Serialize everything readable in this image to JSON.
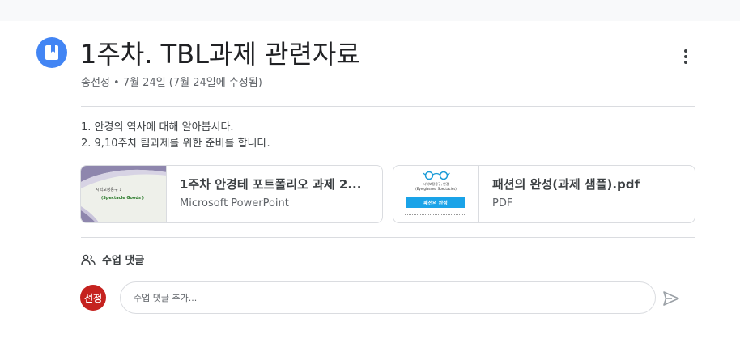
{
  "post": {
    "title": "1주차. TBL과제 관련자료",
    "meta": "송선정 • 7월 24일 (7월 24일에 수정됨)",
    "icon": "assignment-material-icon",
    "accent_color": "#4285f4"
  },
  "description": {
    "lines": [
      "1. 안경의 역사에 대해 알아봅시다.",
      "2. 9,10주차 팀과제를 위한 준비를 합니다."
    ]
  },
  "attachments": [
    {
      "title": "1주차 안경테 포트폴리오 과제 2...",
      "type": "Microsoft PowerPoint",
      "thumb_title": "시력보정용구 1",
      "thumb_subtitle": "(Spectacle Goods )"
    },
    {
      "title": "패션의 완성(과제 샘플).pdf",
      "type": "PDF",
      "thumb_line1": "시력보정용구, 안경",
      "thumb_line2": "(Eye glasses, Spectacles)",
      "thumb_banner": "패션의 완성"
    }
  ],
  "comments": {
    "header": "수업 댓글",
    "avatar_text": "선정",
    "avatar_color": "#c5221f",
    "input_placeholder": "수업 댓글 추가..."
  }
}
